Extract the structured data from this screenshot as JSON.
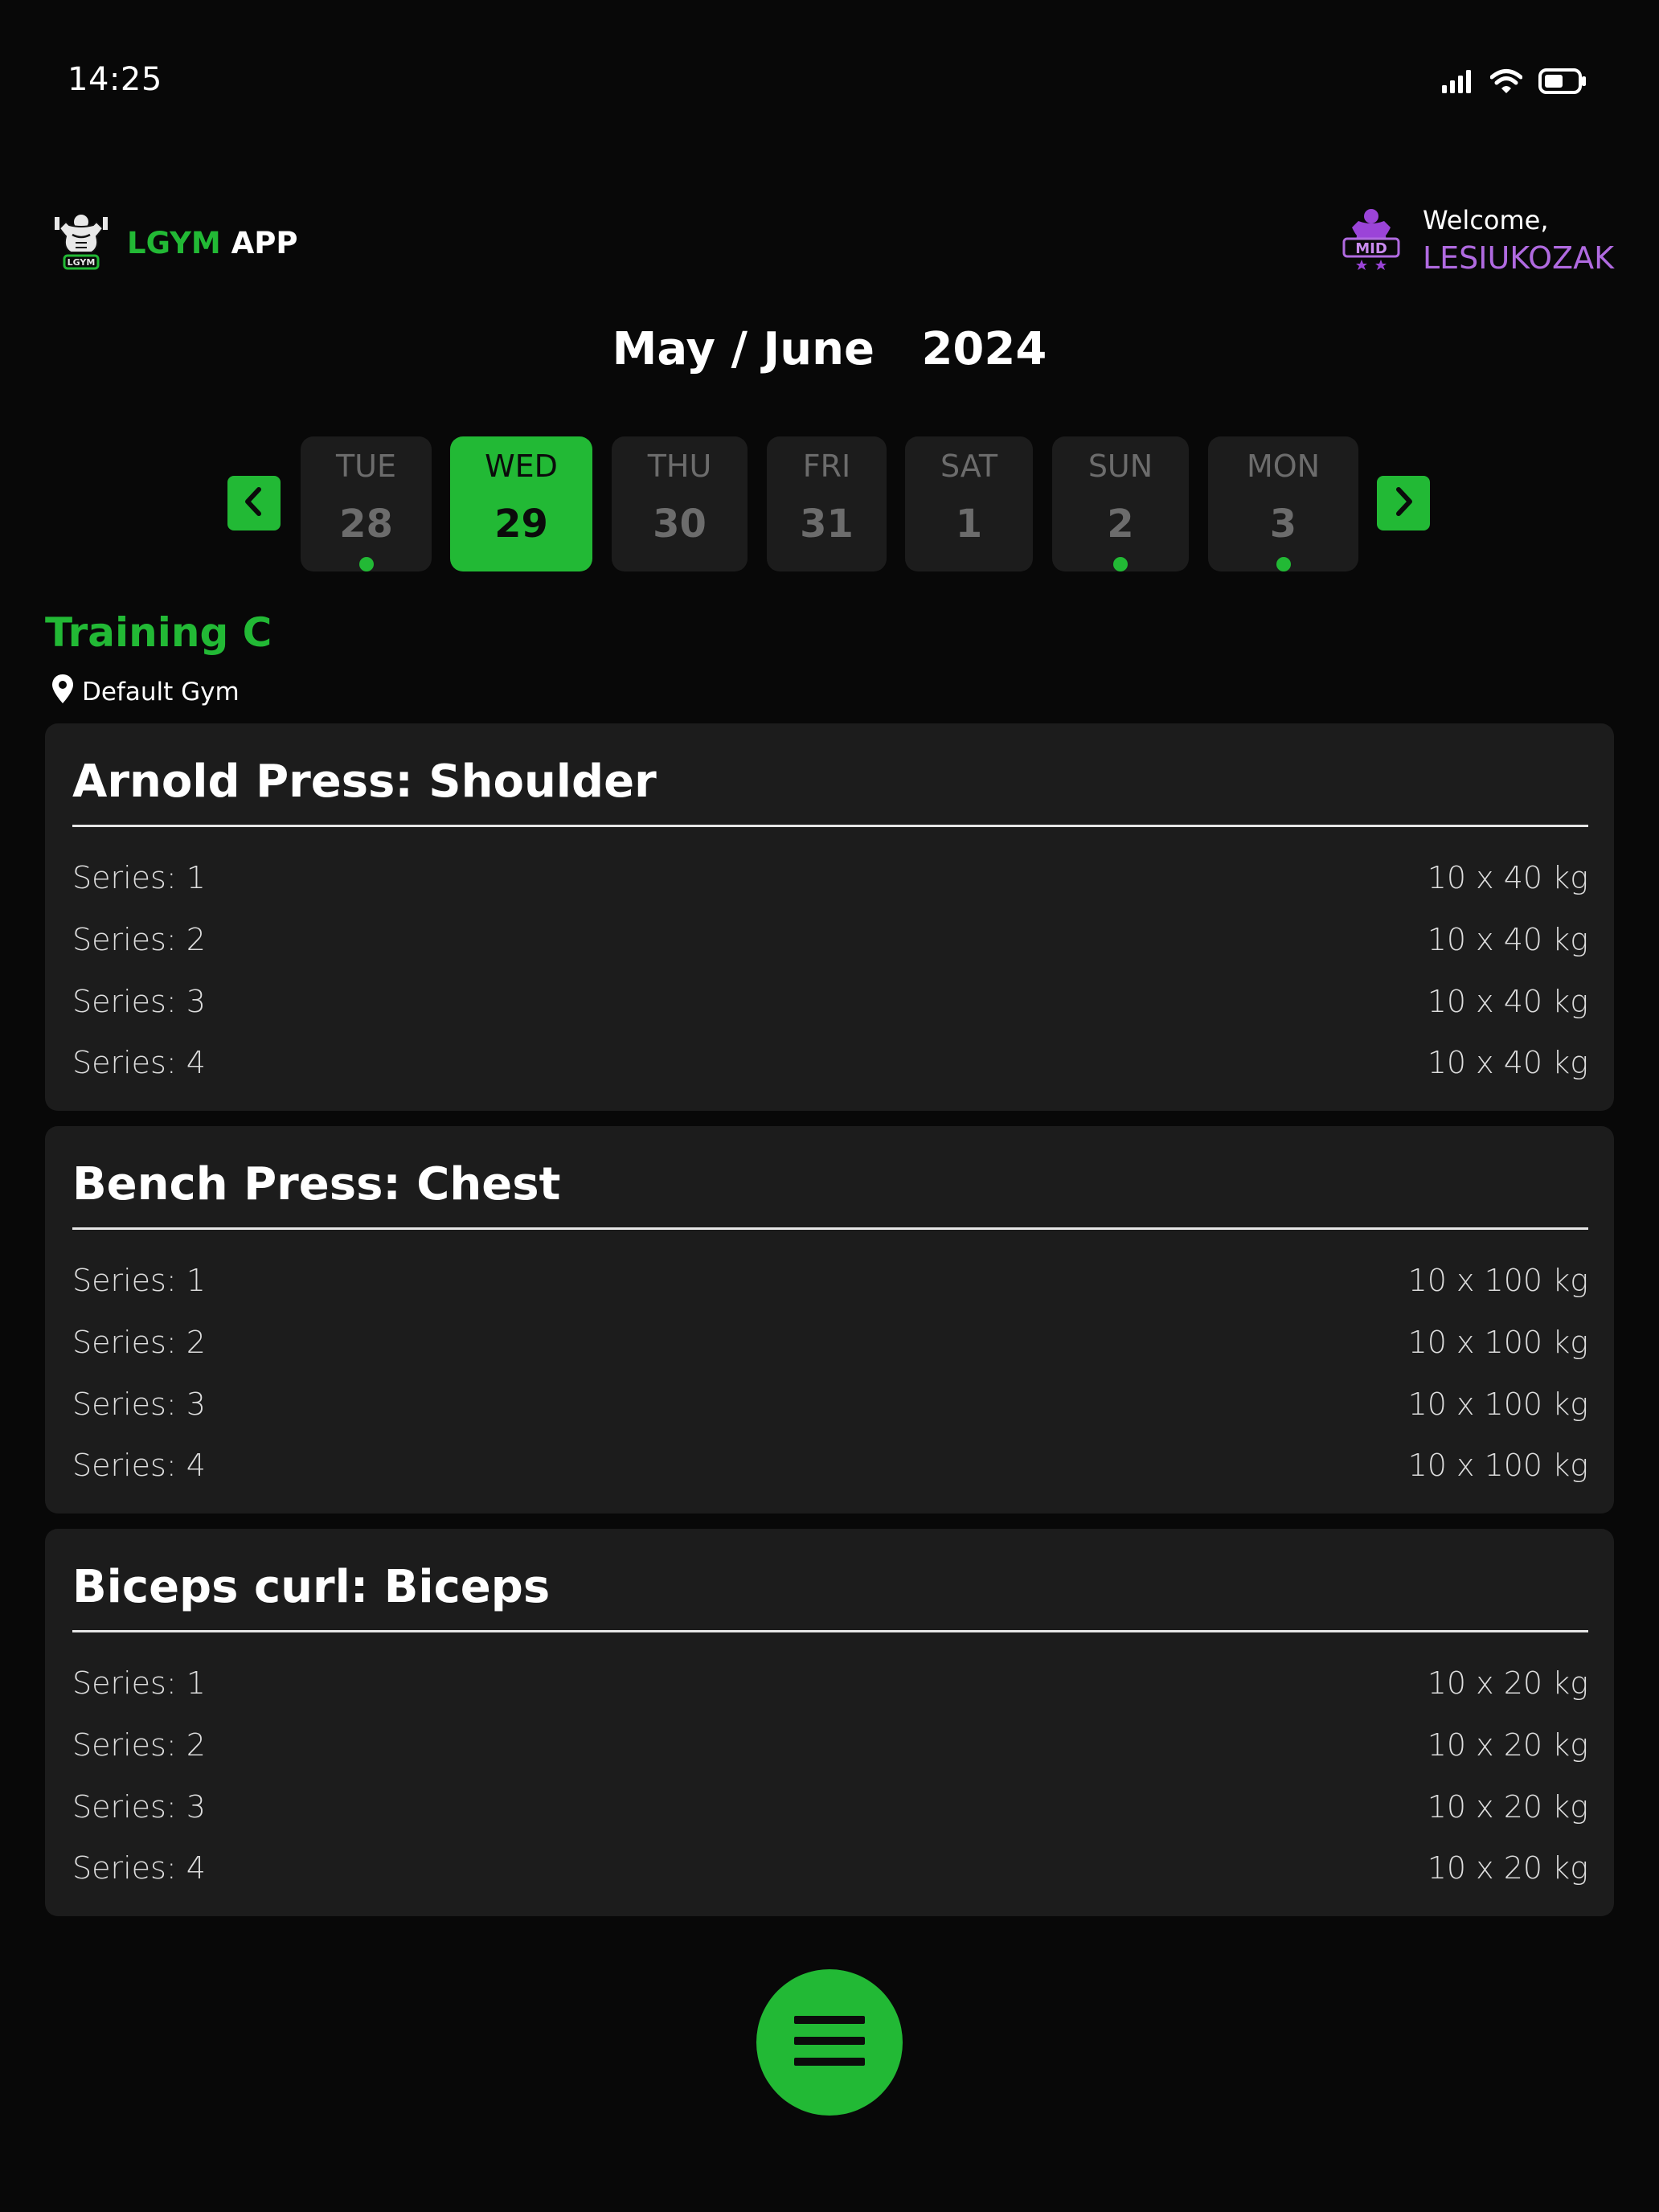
{
  "status_bar": {
    "time": "14:25"
  },
  "header": {
    "brand_primary": "LGYM",
    "brand_secondary": "APP",
    "welcome_label": "Welcome,",
    "username": "LESIUKOZAK"
  },
  "calendar": {
    "month_label": "May / June",
    "year": "2024",
    "days": [
      {
        "dow": "TUE",
        "num": "28",
        "has_training": true,
        "selected": false
      },
      {
        "dow": "WED",
        "num": "29",
        "has_training": true,
        "selected": true
      },
      {
        "dow": "THU",
        "num": "30",
        "has_training": false,
        "selected": false
      },
      {
        "dow": "FRI",
        "num": "31",
        "has_training": false,
        "selected": false
      },
      {
        "dow": "SAT",
        "num": "1",
        "has_training": false,
        "selected": false
      },
      {
        "dow": "SUN",
        "num": "2",
        "has_training": true,
        "selected": false
      },
      {
        "dow": "MON",
        "num": "3",
        "has_training": true,
        "selected": false
      }
    ]
  },
  "training": {
    "title": "Training C",
    "gym": "Default Gym",
    "exercises": [
      {
        "name": "Arnold Press: Shoulder",
        "series": [
          {
            "label": "Series: 1",
            "value": "10 x 40 kg"
          },
          {
            "label": "Series: 2",
            "value": "10 x 40 kg"
          },
          {
            "label": "Series: 3",
            "value": "10 x 40 kg"
          },
          {
            "label": "Series: 4",
            "value": "10 x 40 kg"
          }
        ]
      },
      {
        "name": "Bench Press: Chest",
        "series": [
          {
            "label": "Series: 1",
            "value": "10 x 100 kg"
          },
          {
            "label": "Series: 2",
            "value": "10 x 100 kg"
          },
          {
            "label": "Series: 3",
            "value": "10 x 100 kg"
          },
          {
            "label": "Series: 4",
            "value": "10 x 100 kg"
          }
        ]
      },
      {
        "name": "Biceps curl: Biceps",
        "series": [
          {
            "label": "Series: 1",
            "value": "10 x 20 kg"
          },
          {
            "label": "Series: 2",
            "value": "10 x 20 kg"
          },
          {
            "label": "Series: 3",
            "value": "10 x 20 kg"
          },
          {
            "label": "Series: 4",
            "value": "10 x 20 kg"
          }
        ]
      }
    ]
  },
  "icons": {
    "status": [
      "signal-icon",
      "wifi-icon",
      "battery-icon"
    ],
    "brand_logo": "bodybuilder-logo-icon",
    "user_avatar": "mid-rank-avatar-icon",
    "location": "map-pin-icon",
    "prev": "chevron-left-icon",
    "next": "chevron-right-icon",
    "menu": "hamburger-menu-icon"
  },
  "colors": {
    "accent": "#22b935",
    "background": "#080808",
    "card": "#1c1c1c",
    "username": "#b06ae0"
  }
}
